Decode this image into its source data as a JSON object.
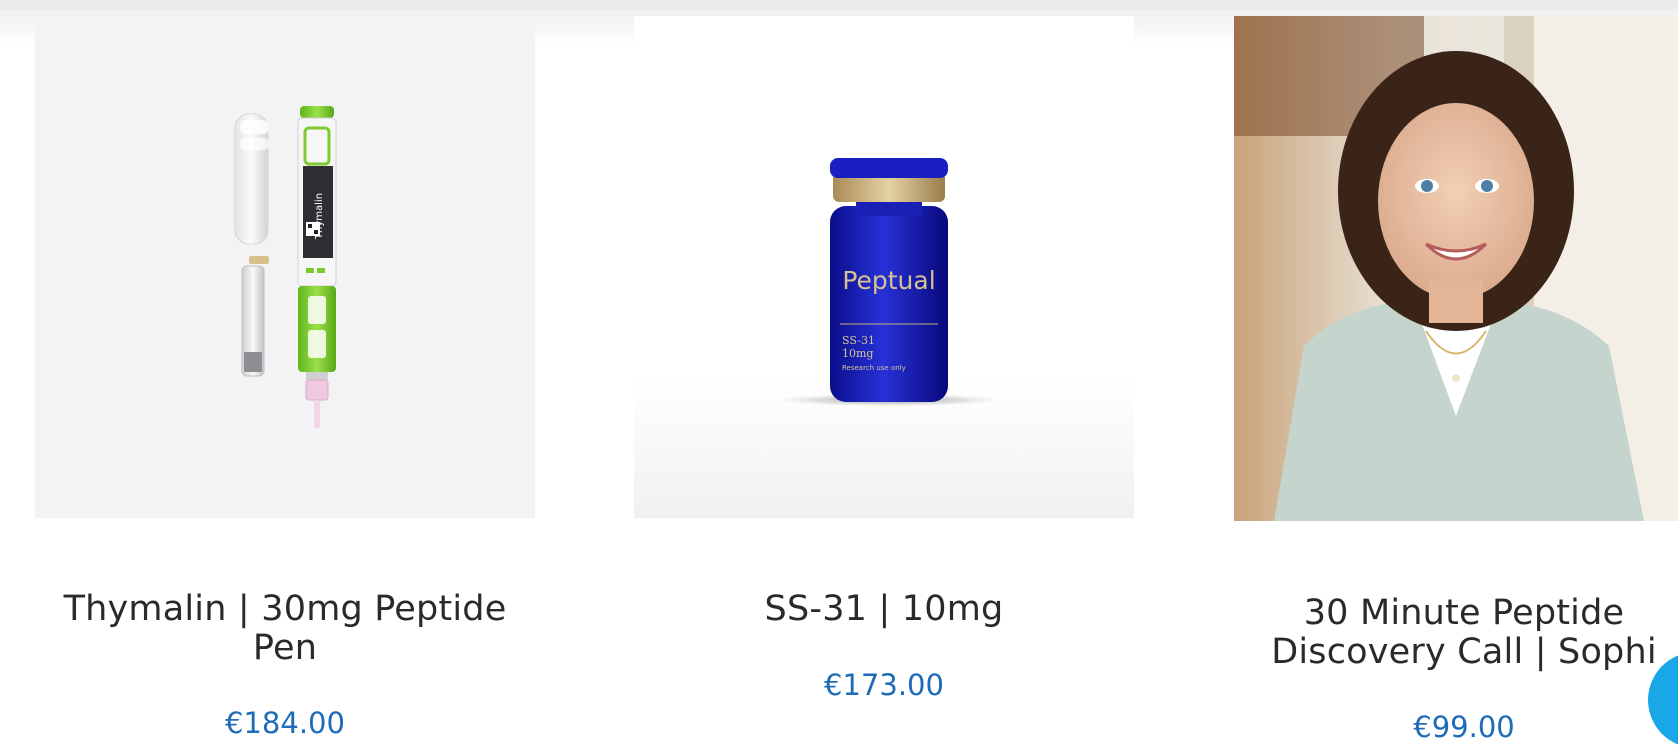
{
  "theme": {
    "price_color": "#1e6cb8",
    "title_color": "#2a2a2a",
    "chat_color": "#19a7e8"
  },
  "products": [
    {
      "title": "Thymalin | 30mg Peptide Pen",
      "price": "€184.00",
      "image": {
        "kind": "peptide-pen",
        "pen_label": "Thymalin"
      }
    },
    {
      "title": "SS-31 | 10mg",
      "price": "€173.00",
      "image": {
        "kind": "vial",
        "brand": "Peptual",
        "line1": "SS-31",
        "line2": "10mg",
        "line3": "Research use only"
      }
    },
    {
      "title": "30 Minute Peptide Discovery Call | Sophi",
      "price": "€99.00",
      "image": {
        "kind": "portrait"
      }
    }
  ],
  "chat": {
    "icon": "chat-bubble-icon"
  }
}
